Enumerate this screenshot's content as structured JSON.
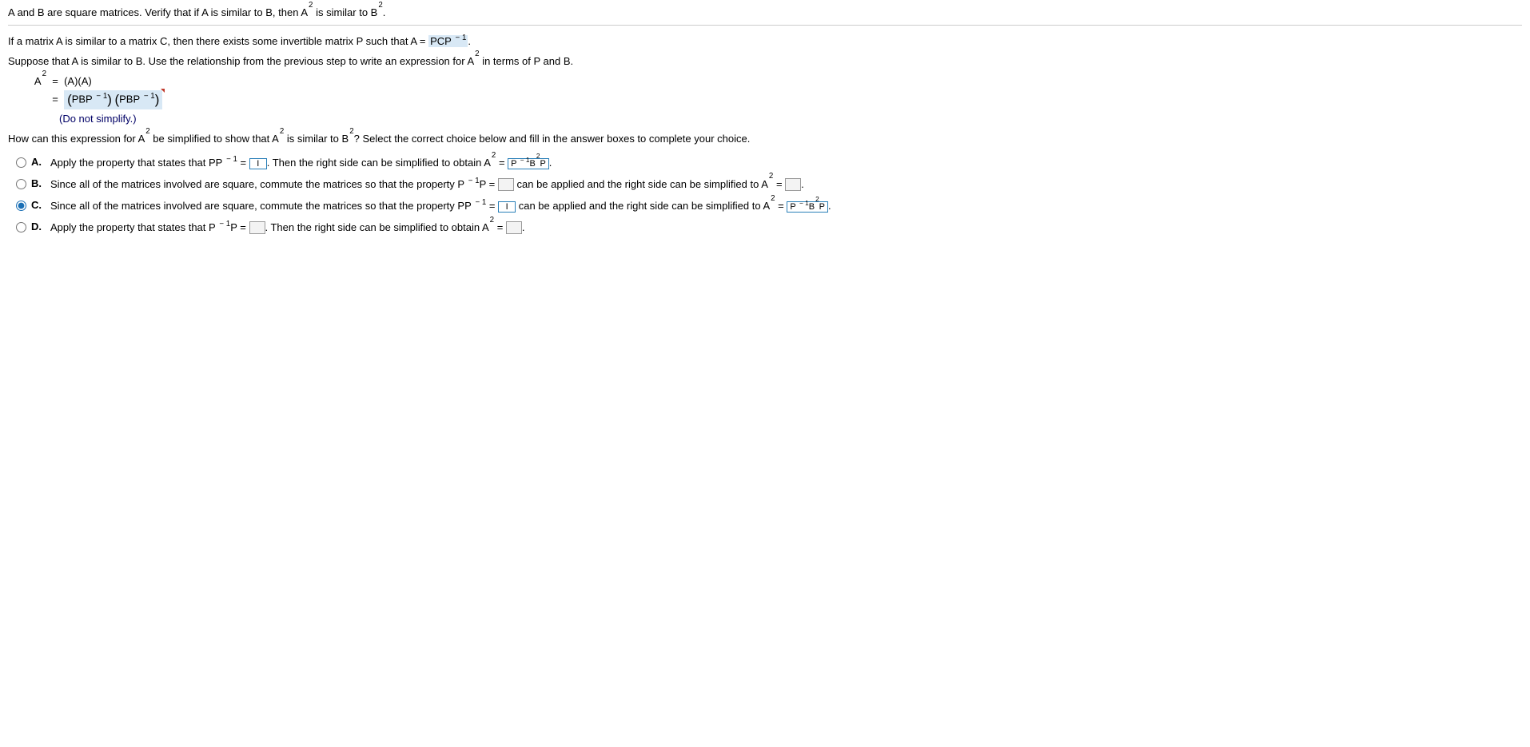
{
  "header": {
    "problem": "A and B are square matrices. Verify that if A is similar to B, then A",
    "problem_sup": "2",
    "problem_tail": " is similar to B",
    "problem_sup2": "2",
    "problem_end": "."
  },
  "step1": {
    "prefix": "If a matrix A is similar to a matrix C, then there exists some invertible matrix P such that A = ",
    "answer": "PCP",
    "answer_exp": " − 1",
    "suffix": "."
  },
  "step2": {
    "text_a": "Suppose that A is similar to B. Use the relationship from the previous step to write an expression for A",
    "sup": "2",
    "text_b": " in terms of P and B."
  },
  "eq": {
    "lhs1": "A",
    "lhs1_sup": "2",
    "eq": "=",
    "rhs1": "(A)(A)",
    "rhs2_a": "PBP",
    "rhs2_exp": " − 1",
    "note": "(Do not simplify.)"
  },
  "question": {
    "a": "How can this expression for A",
    "s1": "2",
    "b": " be simplified to show that A",
    "s2": "2",
    "c": " is similar to B",
    "s3": "2",
    "d": "? Select the correct choice below and fill in the answer boxes to complete your choice."
  },
  "choices": {
    "A": {
      "label": "A.",
      "text_a": "Apply the property that states that PP",
      "exp1": " − 1",
      "text_b": " = ",
      "box1": "I",
      "text_c": ". Then the right side can be simplified to obtain A",
      "sup": "2",
      "text_d": " = ",
      "box2_a": "P",
      "box2_exp": " − 1",
      "box2_b": "B",
      "box2_sup": "2",
      "box2_c": "P",
      "text_e": "."
    },
    "B": {
      "label": "B.",
      "text_a": "Since all of the matrices involved are square, commute the matrices so that the property P",
      "exp1": " − 1",
      "text_b": "P = ",
      "text_c": " can be applied and the right side can be simplified to A",
      "sup": "2",
      "text_d": " = ",
      "text_e": "."
    },
    "C": {
      "label": "C.",
      "text_a": "Since all of the matrices involved are square, commute the matrices so that the property PP",
      "exp1": " − 1",
      "text_b": " = ",
      "box1": "I",
      "text_c": " can be applied and the right side can be simplified to A",
      "sup": "2",
      "text_d": " = ",
      "box2_a": "P",
      "box2_exp": " − 1",
      "box2_b": "B",
      "box2_sup": "2",
      "box2_c": "P",
      "text_e": "."
    },
    "D": {
      "label": "D.",
      "text_a": "Apply the property that states that P",
      "exp1": " − 1",
      "text_b": "P = ",
      "text_c": ". Then the right side can be simplified to obtain A",
      "sup": "2",
      "text_d": " = ",
      "text_e": "."
    }
  }
}
